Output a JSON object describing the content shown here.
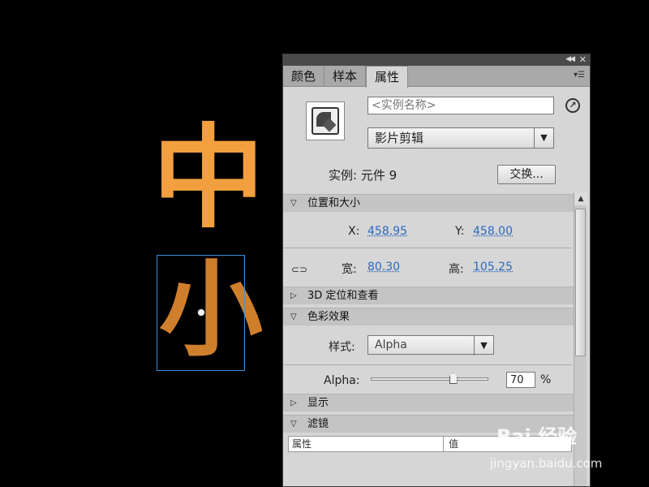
{
  "canvas": {
    "glyph_top": "中",
    "glyph_bottom": "小"
  },
  "panel": {
    "tabs": [
      {
        "label": "颜色"
      },
      {
        "label": "样本"
      },
      {
        "label": "属性"
      }
    ],
    "instance_name_placeholder": "<实例名称>",
    "symbol_type": "影片剪辑",
    "instance_of": "实例: 元件 9",
    "swap_label": "交换...",
    "sections": {
      "position_size": "位置和大小",
      "position_3d": "3D 定位和查看",
      "color_effect": "色彩效果",
      "display": "显示",
      "filters": "滤镜"
    },
    "position": {
      "x_label": "X:",
      "x_value": "458.95",
      "y_label": "Y:",
      "y_value": "458.00",
      "width_label": "宽:",
      "width_value": "80.30",
      "height_label": "高:",
      "height_value": "105.25"
    },
    "color_effect": {
      "style_label": "样式:",
      "style_value": "Alpha",
      "alpha_label": "Alpha:",
      "alpha_value": "70",
      "alpha_unit": "%",
      "alpha_slider_fraction": 0.7
    },
    "filters_table": {
      "col_property": "属性",
      "col_value": "值"
    }
  },
  "watermark": {
    "brand": "Bai 经验",
    "url": "jingyan.baidu.com"
  },
  "colors": {
    "glyph_top": "#f2a03f",
    "glyph_bottom": "#cf7f2b",
    "selection": "#3a8edb",
    "value_link": "#2a6bbd"
  }
}
